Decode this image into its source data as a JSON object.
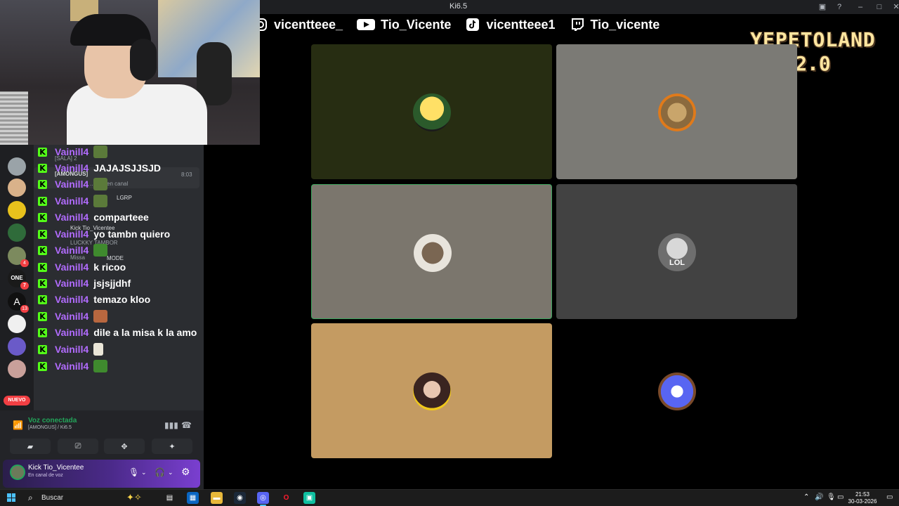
{
  "window": {
    "title": "Ki6.5"
  },
  "socials": [
    {
      "platform": "instagram-icon",
      "handle": "vicentteee_"
    },
    {
      "platform": "youtube-icon",
      "handle": "Tio_Vicente"
    },
    {
      "platform": "tiktok-icon",
      "handle": "vicentteee1"
    },
    {
      "platform": "twitch-icon",
      "handle": "Tio_vicente"
    }
  ],
  "logo": {
    "line1": "YEPETOLAND",
    "line2": "2.0"
  },
  "servers": {
    "badges": [
      "4",
      "7",
      "13"
    ],
    "new_label": "NUEVO"
  },
  "chat": {
    "messages": [
      {
        "user": "Vainill4",
        "text": "",
        "emote": "frog-emote"
      },
      {
        "user": "Vainill4",
        "text": "JAJAJSJJSJD",
        "emote": ""
      },
      {
        "user": "Vainill4",
        "text": "",
        "emote": "frog-emote"
      },
      {
        "user": "Vainill4",
        "text": "",
        "emote": "frog-emote"
      },
      {
        "user": "Vainill4",
        "text": "comparteee",
        "emote": ""
      },
      {
        "user": "Vainill4",
        "text": "yo tambn quiero",
        "emote": ""
      },
      {
        "user": "Vainill4",
        "text": "",
        "emote": "pepe-emote"
      },
      {
        "user": "Vainill4",
        "text": "k ricoo",
        "emote": ""
      },
      {
        "user": "Vainill4",
        "text": "jsjsjjdhf",
        "emote": ""
      },
      {
        "user": "Vainill4",
        "text": "temazo kloo",
        "emote": ""
      },
      {
        "user": "Vainill4",
        "text": "",
        "emote": "face-emote"
      },
      {
        "user": "Vainill4",
        "text": "dile a la misa k la amo",
        "emote": ""
      },
      {
        "user": "Vainill4",
        "text": "",
        "emote": "goose-emote"
      },
      {
        "user": "Vainill4",
        "text": "",
        "emote": "pepe-emote"
      }
    ],
    "ghost": {
      "sala": "[SALA] 2",
      "amongus": "[AMONGUS]",
      "time": "8:03",
      "canal": "...esta en canal",
      "lgrp": "LGRP",
      "kick_user": "Kick Tio_Vicentee",
      "lucky": "LUCKKY TAMBOR",
      "missa": "Missa",
      "mode": "MODE"
    }
  },
  "voice": {
    "status": "Voz conectada",
    "channel": "[AMONGUS]  / Ki6.5"
  },
  "user": {
    "name": "Kick Tio_Vicentee",
    "status": "En canal de voz"
  },
  "grid": {
    "tiles": [
      {
        "name": "tile-user-1",
        "bg": "#272d12",
        "speaking": false
      },
      {
        "name": "tile-user-2",
        "bg": "#7b7a75",
        "speaking": false
      },
      {
        "name": "tile-user-3",
        "bg": "#7b766d",
        "speaking": true
      },
      {
        "name": "tile-user-4",
        "bg": "#424242",
        "speaking": false
      },
      {
        "name": "tile-user-5",
        "bg": "#c49b62",
        "speaking": false
      },
      {
        "name": "tile-user-6",
        "bg": "#000000",
        "speaking": false
      }
    ],
    "avatar_label": "LOL"
  },
  "taskbar": {
    "search_label": "Buscar",
    "time": "21:53",
    "date": "30-03-2026"
  },
  "colors": {
    "kick_green": "#53fc18",
    "username_purple": "#b26cff",
    "discord_green": "#23a55a",
    "discord_red": "#f23f43"
  }
}
